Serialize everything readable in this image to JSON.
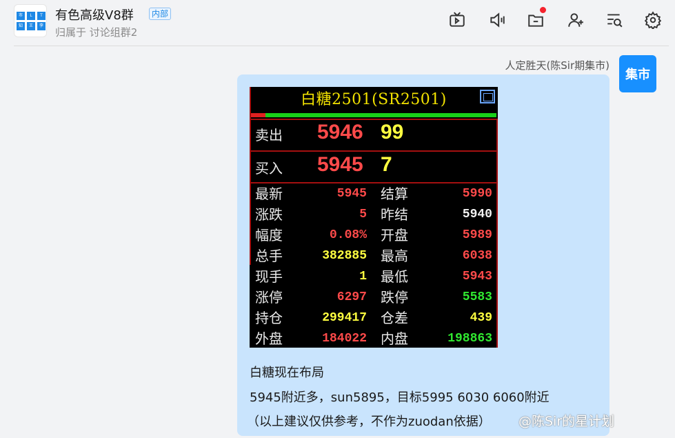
{
  "header": {
    "avatar_cells": [
      "市",
      "L",
      "T",
      "知",
      "王",
      "李"
    ],
    "title": "有色高级V8群",
    "tag": "内部",
    "subtitle": "归属于 讨论组群2",
    "icons": [
      "tv-icon",
      "speaker-icon",
      "folder-icon",
      "add-user-icon",
      "search-list-icon",
      "settings-icon"
    ]
  },
  "message": {
    "sender_name": "人定胜天(陈Sir期集市)",
    "sender_avatar_text": "集市",
    "quote": {
      "title": "白糖2501(SR2501)",
      "sell_label": "卖出",
      "sell_price": "5946",
      "sell_volume": "99",
      "buy_label": "买入",
      "buy_price": "5945",
      "buy_volume": "7",
      "rows": [
        {
          "label": "最新",
          "value": "5945",
          "value_color": "red",
          "label2": "结算",
          "value2": "5990",
          "value2_color": "red"
        },
        {
          "label": "涨跌",
          "value": "5",
          "value_color": "red",
          "label2": "昨结",
          "value2": "5940",
          "value2_color": "white"
        },
        {
          "label": "幅度",
          "value": "0.08%",
          "value_color": "red",
          "label2": "开盘",
          "value2": "5989",
          "value2_color": "red"
        },
        {
          "label": "总手",
          "value": "382885",
          "value_color": "yellow",
          "label2": "最高",
          "value2": "6038",
          "value2_color": "red"
        },
        {
          "label": "现手",
          "value": "1",
          "value_color": "yellow",
          "label2": "最低",
          "value2": "5943",
          "value2_color": "red"
        },
        {
          "label": "涨停",
          "value": "6297",
          "value_color": "red",
          "label2": "跌停",
          "value2": "5583",
          "value2_color": "green"
        },
        {
          "label": "持仓",
          "value": "299417",
          "value_color": "yellow",
          "label2": "仓差",
          "value2": "439",
          "value2_color": "yellow"
        },
        {
          "label": "外盘",
          "value": "184022",
          "value_color": "red",
          "label2": "内盘",
          "value2": "198863",
          "value2_color": "green"
        }
      ]
    },
    "text_lines": [
      "白糖现在布局",
      "5945附近多，sun5895，目标5995 6030 6060附近",
      "（以上建议仅供参考，不作为zuodan依据）"
    ]
  },
  "watermark": "@陈Sir的星计划",
  "colors": {
    "accent": "#1890ff",
    "bubble": "#c9e4fd",
    "quote_bg": "#000000",
    "up_red": "#ff4a4a",
    "down_green": "#30e830",
    "volume_yellow": "#ffff40"
  }
}
